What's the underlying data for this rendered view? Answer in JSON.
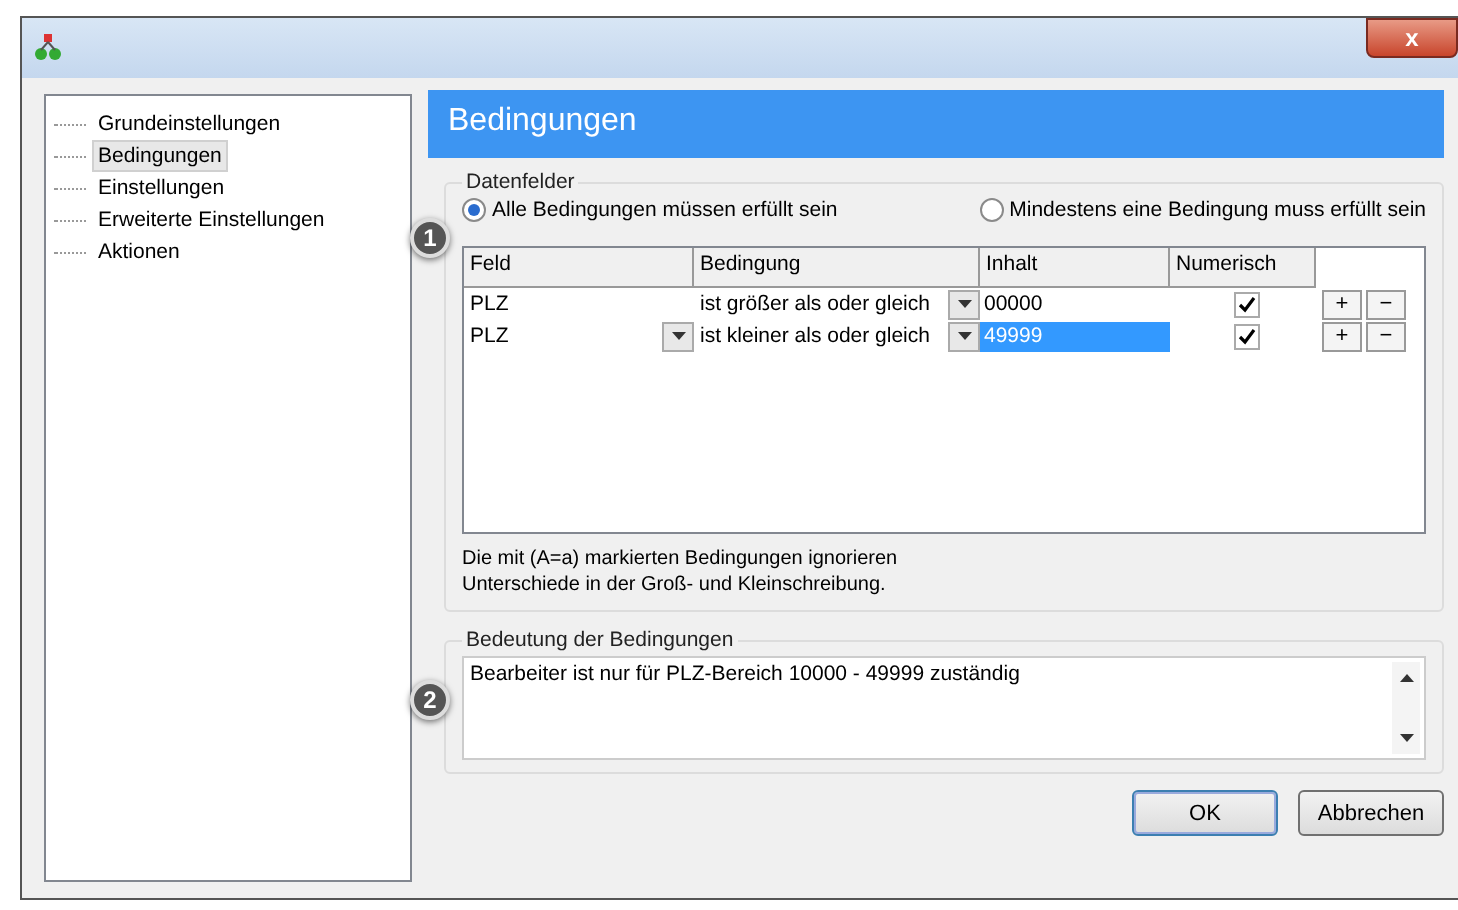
{
  "window": {
    "close_label": "x"
  },
  "tree": {
    "items": [
      {
        "label": "Grundeinstellungen",
        "selected": false
      },
      {
        "label": "Bedingungen",
        "selected": true
      },
      {
        "label": "Einstellungen",
        "selected": false
      },
      {
        "label": "Erweiterte Einstellungen",
        "selected": false
      },
      {
        "label": "Aktionen",
        "selected": false
      }
    ]
  },
  "header": {
    "title": "Bedingungen"
  },
  "datenfelder": {
    "legend": "Datenfelder",
    "badge": "1",
    "options": [
      {
        "label": "Alle Bedingungen müssen erfüllt sein",
        "selected": true
      },
      {
        "label": "Mindestens eine Bedingung muss erfüllt sein",
        "selected": false
      }
    ],
    "table": {
      "columns": [
        "Feld",
        "Bedingung",
        "Inhalt",
        "Numerisch"
      ],
      "rows": [
        {
          "feld": "PLZ",
          "bedingung": "ist größer als oder gleich",
          "inhalt": "00000",
          "numerisch": true,
          "editing": false,
          "add": "+",
          "remove": "−"
        },
        {
          "feld": "PLZ",
          "bedingung": "ist kleiner als oder gleich",
          "inhalt": "49999",
          "numerisch": true,
          "editing": true,
          "add": "+",
          "remove": "−"
        }
      ]
    },
    "note": "Die mit (A=a) markierten Bedingungen ignorieren Unterschiede in der Groß- und Kleinschreibung."
  },
  "bedeutung": {
    "legend": "Bedeutung der Bedingungen",
    "badge": "2",
    "text": "Bearbeiter ist nur für PLZ-Bereich 10000 - 49999 zuständig"
  },
  "buttons": [
    {
      "label": "OK",
      "default": true
    },
    {
      "label": "Abbrechen",
      "default": false
    }
  ]
}
